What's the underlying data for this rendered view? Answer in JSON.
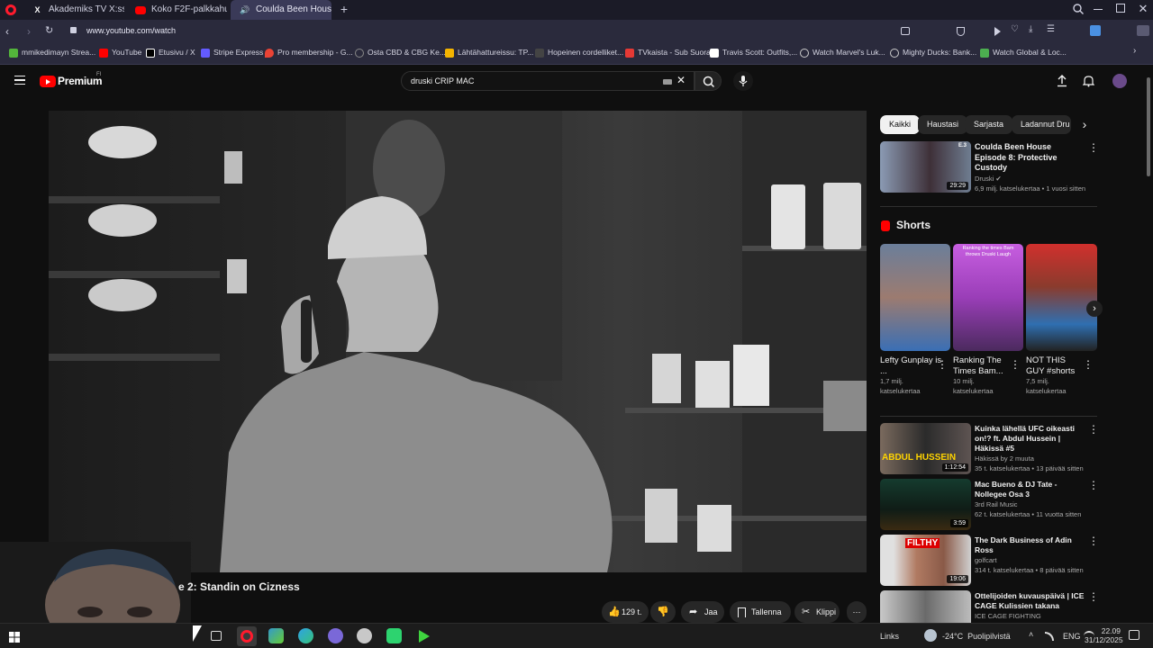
{
  "browser": {
    "tabs": [
      {
        "label": "Akademiks TV X:ssä: \"Ex:S",
        "icon": "x-logo-icon",
        "active": false
      },
      {
        "label": "Koko F2F-palkkahuijaus -",
        "icon": "youtube-icon",
        "active": false
      },
      {
        "label": "Coulda Been House E",
        "icon": "audio-playing-icon",
        "active": true
      }
    ],
    "url": "www.youtube.com/watch",
    "bookmarks": [
      {
        "label": "mmikedimayn Strea...",
        "color": "#53b53b"
      },
      {
        "label": "YouTube",
        "color": "#ff0000"
      },
      {
        "label": "Etusivu / X",
        "color": "#ffffff"
      },
      {
        "label": "Stripe Express",
        "color": "#635bff"
      },
      {
        "label": "Pro membership - G...",
        "color": "#ea4335"
      },
      {
        "label": "Osta CBD & CBG Ke...",
        "color": "#888888"
      },
      {
        "label": "Lähtähattureissu: TP...",
        "color": "#f4b400"
      },
      {
        "label": "Hopeinen cordelliket...",
        "color": "#222222"
      },
      {
        "label": "TVkaista - Sub Suora",
        "color": "#e53935"
      },
      {
        "label": "Travis Scott: Outfits,...",
        "color": "#ffffff"
      },
      {
        "label": "Watch Marvel's Luk...",
        "color": "#cccccc"
      },
      {
        "label": "Mighty Ducks: Bank...",
        "color": "#cccccc"
      },
      {
        "label": "Watch Global & Loc...",
        "color": "#4caf50"
      }
    ]
  },
  "youtube": {
    "logo_text": "Premium",
    "logo_badge": "FI",
    "search_value": "druski CRIP MAC",
    "video": {
      "title_visible": "e 2: Standin on Cizness",
      "likes": "129 t.",
      "actions": {
        "share": "Jaa",
        "save": "Tallenna",
        "clip": "Klippi"
      }
    },
    "chips": [
      "Kaikki",
      "Haustasi",
      "Sarjasta",
      "Ladannut Dru"
    ],
    "top_rec": {
      "title": "Coulda Been House Episode 8: Protective Custody",
      "channel": "Druski",
      "stats": "6,9 milj. katselukertaa • 1 vuosi sitten",
      "duration": "29:29",
      "ep_badge": "E.3"
    },
    "shorts_heading": "Shorts",
    "shorts": [
      {
        "title": "Lefty Gunplay is ...",
        "views": "1,7 milj. katselukertaa"
      },
      {
        "title": "Ranking The Times Bam...",
        "views": "10 milj. katselukertaa",
        "overlay": "Ranking the times Bam throws Druski Laugh"
      },
      {
        "title": "NOT THIS GUY #shorts",
        "views": "7,5 milj. katselukertaa"
      }
    ],
    "recs": [
      {
        "title": "Kuinka lähellä UFC oikeasti on!? ft. Abdul Hussein | Häkissä #5",
        "channel": "Häkissä by 2 muuta",
        "stats": "35 t. katselukertaa • 13 päivää sitten",
        "duration": "1:12:54",
        "thumb_text": "ABDUL HUSSEIN"
      },
      {
        "title": "Mac Bueno & DJ Tate - Nollegee Osa 3",
        "channel": "3rd Rail Music",
        "stats": "62 t. katselukertaa • 11 vuotta sitten",
        "duration": "3:59"
      },
      {
        "title": "The Dark Business of Adin Ross",
        "channel": "golfcart",
        "stats": "314 t. katselukertaa • 8 päivää sitten",
        "duration": "19:06",
        "thumb_text": "FILTHY"
      },
      {
        "title": "Ottelijoiden kuvauspäivä | ICE CAGE Kulissien takana",
        "channel": "ICE CAGE FIGHTING",
        "stats": ""
      }
    ]
  },
  "taskbar": {
    "links_label": "Links",
    "weather": "-24°C  Puolipilvistä",
    "lang": "ENG",
    "time": "22.09",
    "date": "31/12/2025"
  }
}
